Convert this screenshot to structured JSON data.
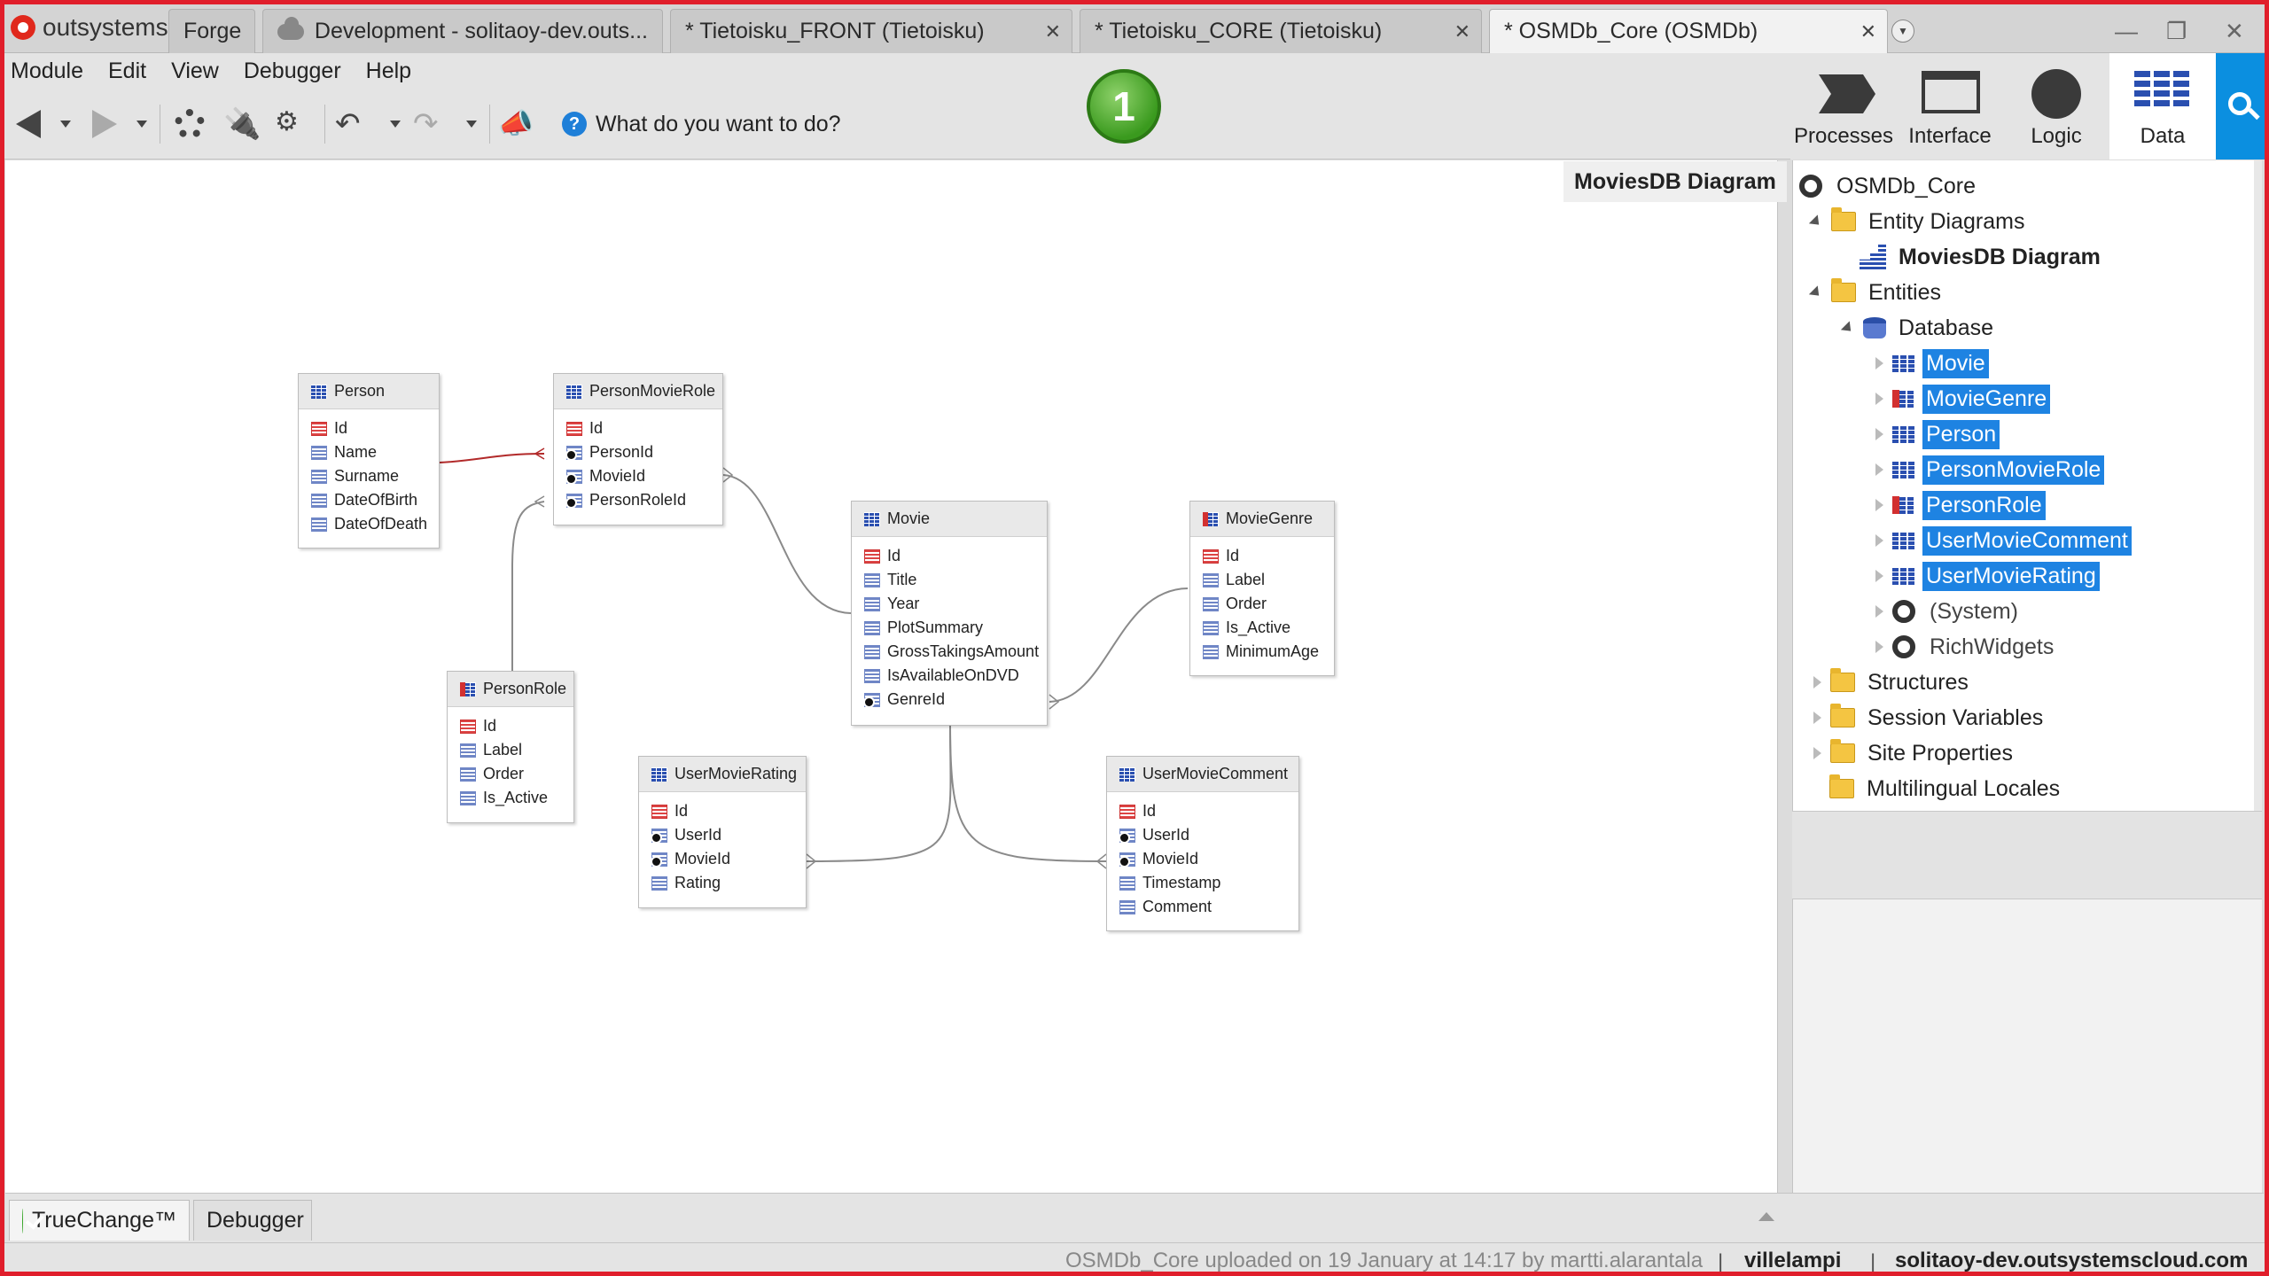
{
  "app": {
    "brand": "outsystems"
  },
  "tabs": [
    {
      "label": "Forge"
    },
    {
      "label": "Development - solitaoy-dev.outs..."
    },
    {
      "label": "* Tietoisku_FRONT (Tietoisku)"
    },
    {
      "label": "* Tietoisku_CORE (Tietoisku)"
    },
    {
      "label": "* OSMDb_Core (OSMDb)"
    }
  ],
  "menu": [
    "Module",
    "Edit",
    "View",
    "Debugger",
    "Help"
  ],
  "toolbar": {
    "help_prompt": "What do you want to do?",
    "badge_count": "1"
  },
  "layers": [
    {
      "label": "Processes",
      "icon": "processes-icon"
    },
    {
      "label": "Interface",
      "icon": "interface-icon"
    },
    {
      "label": "Logic",
      "icon": "logic-icon"
    },
    {
      "label": "Data",
      "icon": "data-icon",
      "active": true
    }
  ],
  "diagram": {
    "title": "MoviesDB Diagram",
    "entities": [
      {
        "name": "Person",
        "attributes": [
          "Id",
          "Name",
          "Surname",
          "DateOfBirth",
          "DateOfDeath"
        ]
      },
      {
        "name": "PersonMovieRole",
        "attributes": [
          "Id",
          "PersonId",
          "MovieId",
          "PersonRoleId"
        ]
      },
      {
        "name": "Movie",
        "attributes": [
          "Id",
          "Title",
          "Year",
          "PlotSummary",
          "GrossTakingsAmount",
          "IsAvailableOnDVD",
          "GenreId"
        ]
      },
      {
        "name": "MovieGenre",
        "attributes": [
          "Id",
          "Label",
          "Order",
          "Is_Active",
          "MinimumAge"
        ]
      },
      {
        "name": "PersonRole",
        "attributes": [
          "Id",
          "Label",
          "Order",
          "Is_Active"
        ]
      },
      {
        "name": "UserMovieRating",
        "attributes": [
          "Id",
          "UserId",
          "MovieId",
          "Rating"
        ]
      },
      {
        "name": "UserMovieComment",
        "attributes": [
          "Id",
          "UserId",
          "MovieId",
          "Timestamp",
          "Comment"
        ]
      }
    ]
  },
  "tree": {
    "root": "OSMDb_Core",
    "entity_diagrams": "Entity Diagrams",
    "diagram_item": "MoviesDB Diagram",
    "entities": "Entities",
    "database": "Database",
    "db_entities": [
      "Movie",
      "MovieGenre",
      "Person",
      "PersonMovieRole",
      "PersonRole",
      "UserMovieComment",
      "UserMovieRating"
    ],
    "system": "(System)",
    "richwidgets": "RichWidgets",
    "structures": "Structures",
    "session_variables": "Session Variables",
    "site_properties": "Site Properties",
    "multilingual_locales": "Multilingual Locales"
  },
  "bottom_tabs": [
    "TrueChange™",
    "Debugger"
  ],
  "status": {
    "upload_info": "OSMDb_Core uploaded on 19 January at 14:17 by martti.alarantala",
    "user": "villelampi",
    "server": "solitaoy-dev.outsystemscloud.com"
  },
  "colors": {
    "selection": "#1e83e2",
    "accent": "#0b8fe0",
    "frame": "#e01e2b"
  }
}
